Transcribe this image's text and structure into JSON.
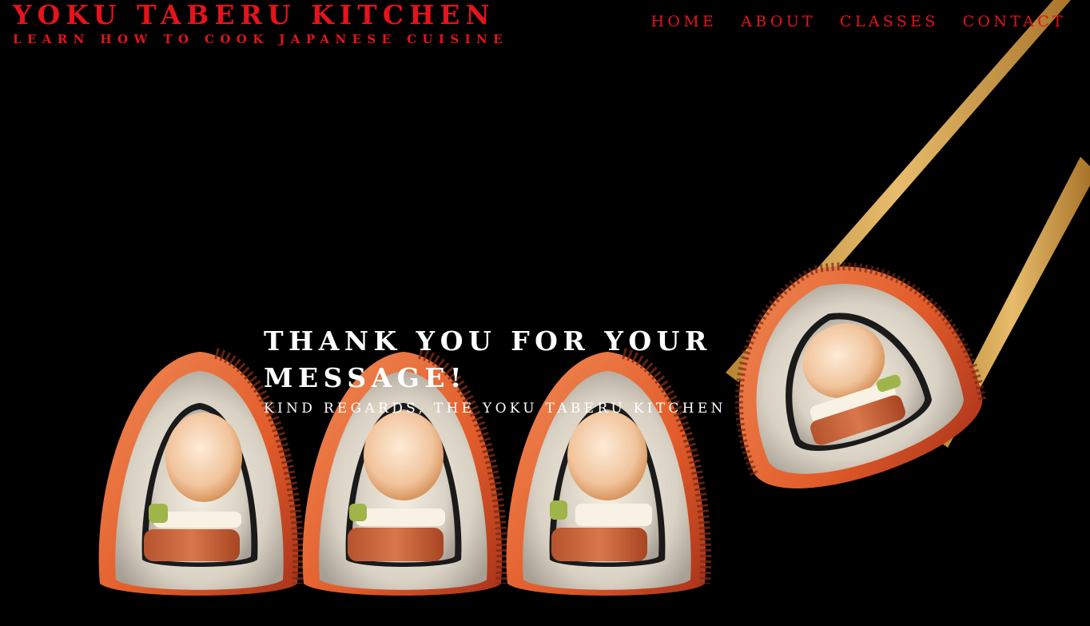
{
  "header": {
    "title": "YOKU TABERU KITCHEN",
    "tagline": "LEARN HOW TO COOK JAPANESE CUISINE"
  },
  "nav": {
    "items": [
      {
        "label": "HOME"
      },
      {
        "label": "ABOUT"
      },
      {
        "label": "CLASSES"
      },
      {
        "label": "CONTACT"
      }
    ]
  },
  "hero": {
    "heading": "THANK YOU FOR YOUR MESSAGE!",
    "subheading": "KIND REGARDS, THE YOKU TABERU KITCHEN"
  },
  "colors": {
    "accent": "#e4141a",
    "background": "#000000",
    "hero_text": "#ffffff"
  }
}
